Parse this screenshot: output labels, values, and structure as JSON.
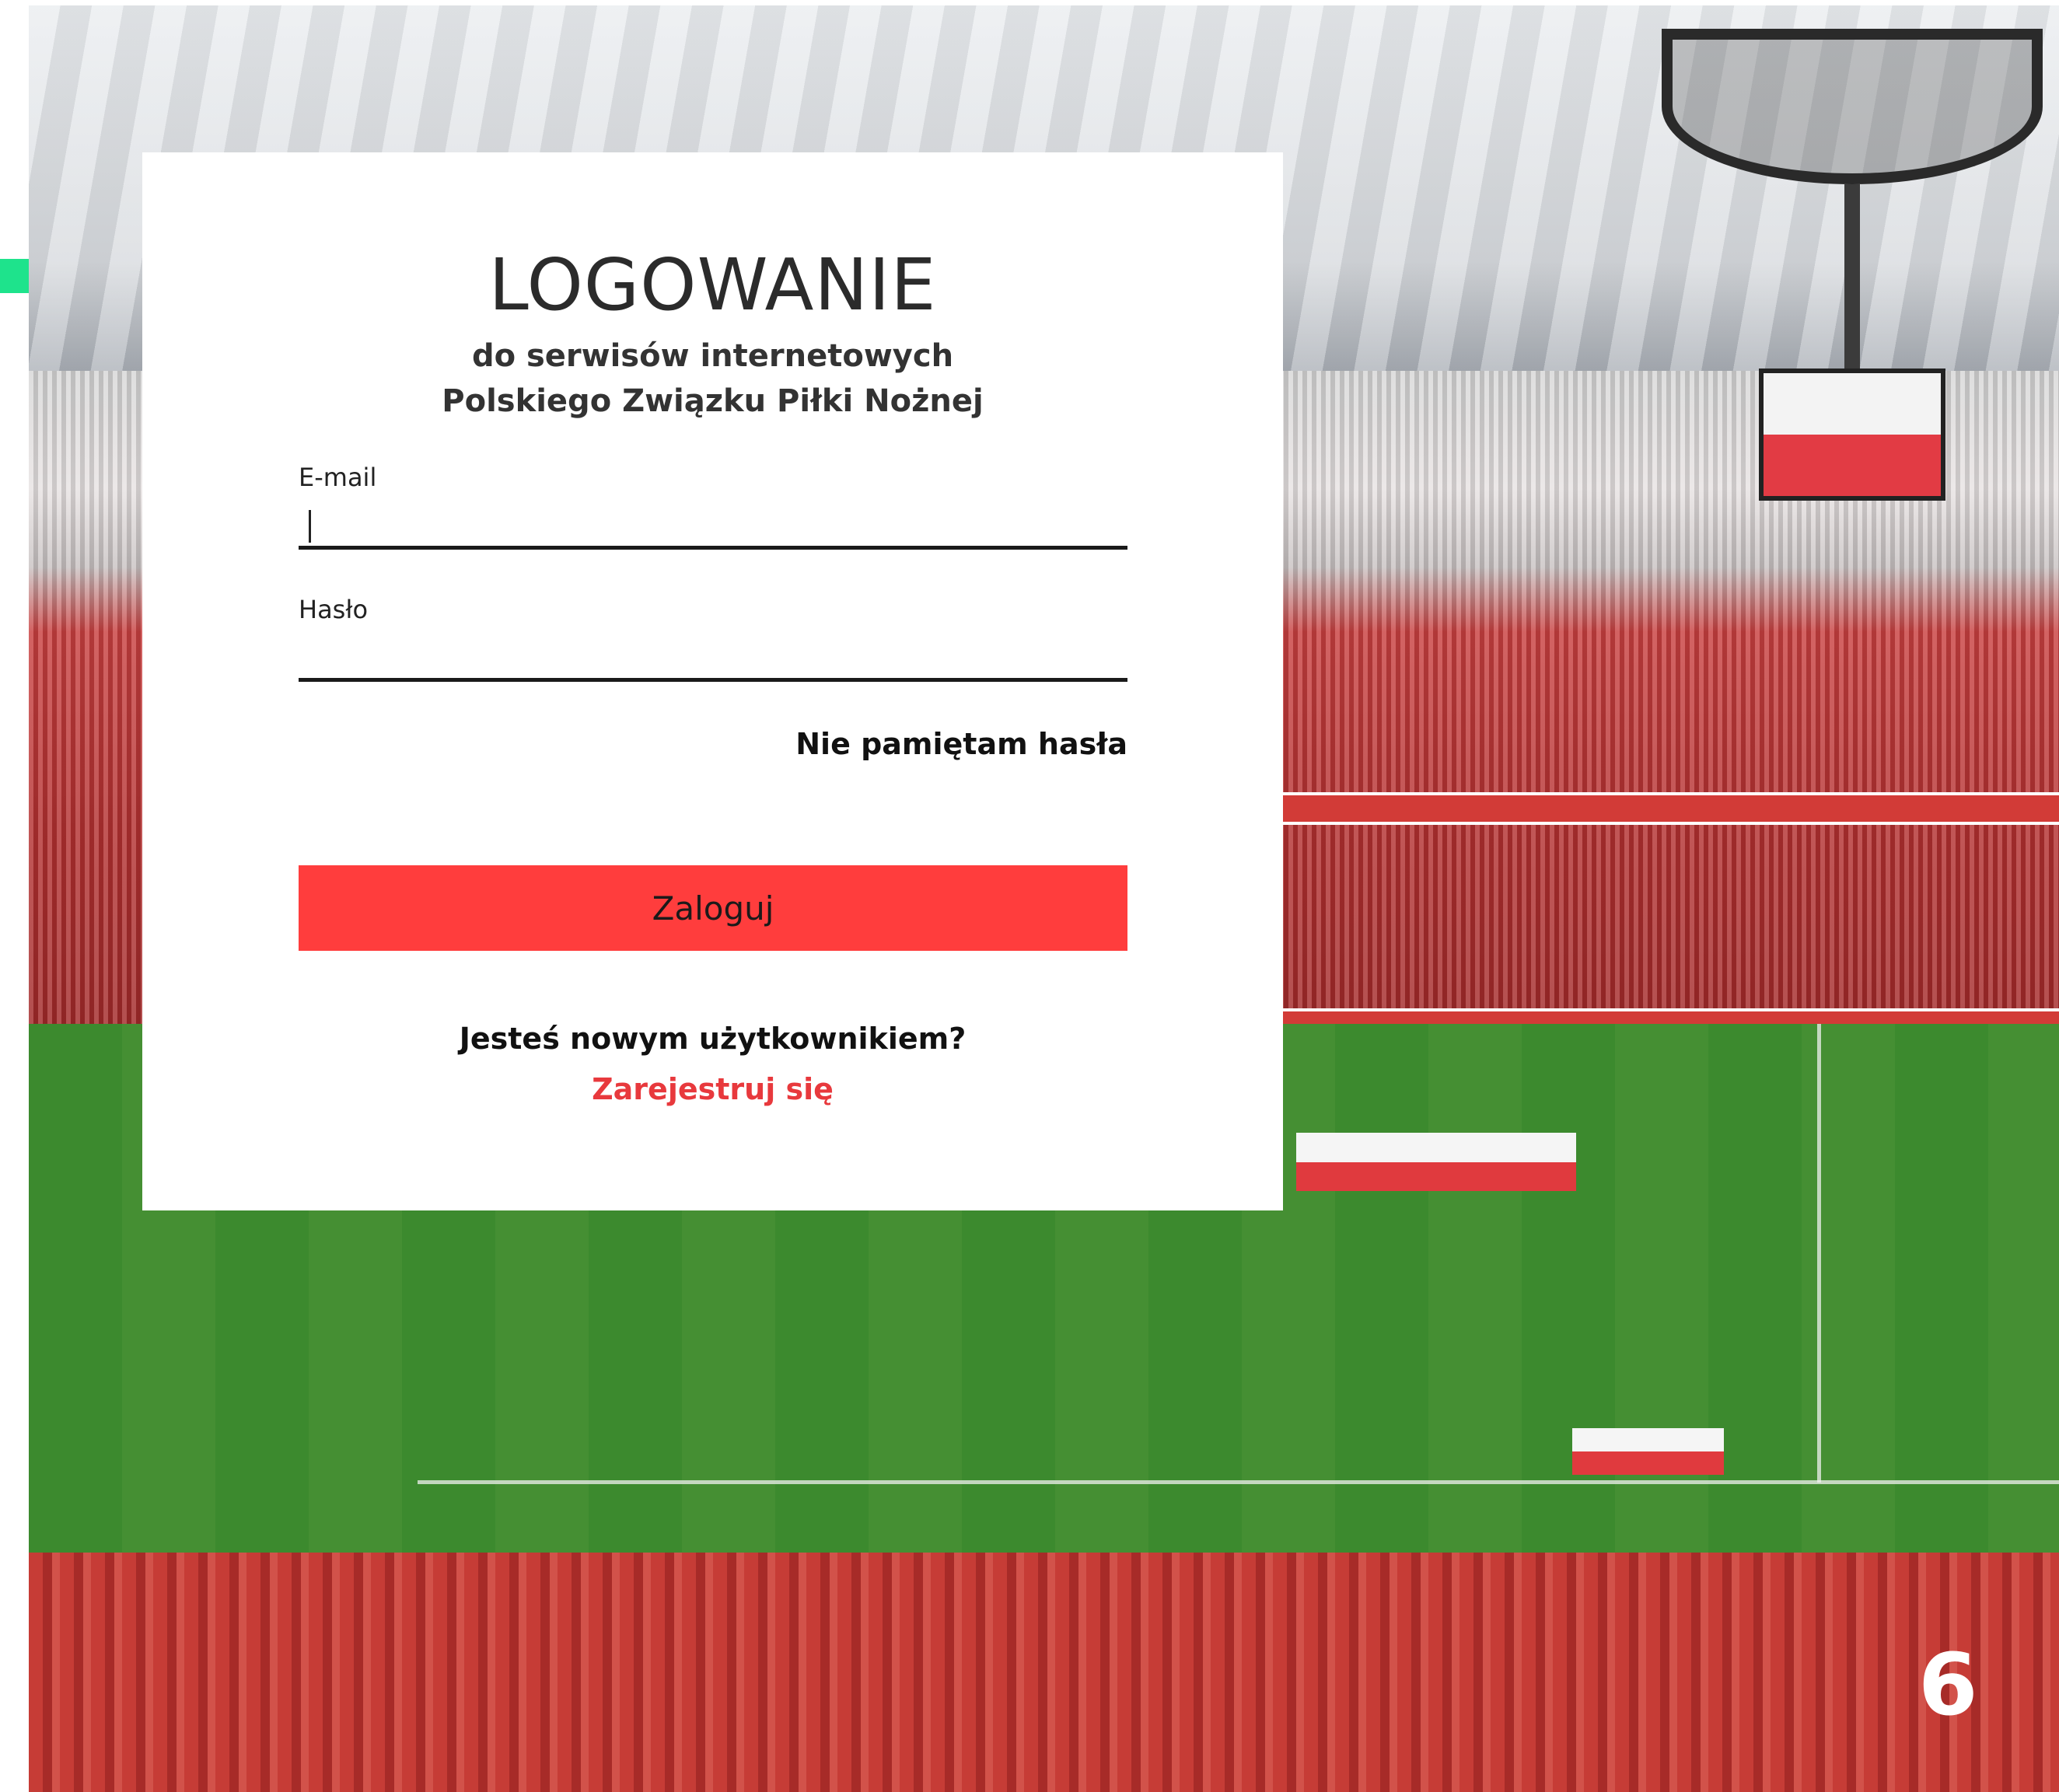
{
  "login": {
    "title": "LOGOWANIE",
    "subtitle_line1": "do serwisów internetowych",
    "subtitle_line2": "Polskiego Związku Piłki Nożnej",
    "email_label": "E-mail",
    "email_value": "",
    "password_label": "Hasło",
    "password_value": "",
    "forgot_label": "Nie pamiętam hasła",
    "submit_label": "Zaloguj",
    "new_user_text": "Jesteś nowym użytkownikiem?",
    "register_label": "Zarejestruj się"
  },
  "background": {
    "badge_text": "6"
  },
  "colors": {
    "accent_red": "#ff3d3d",
    "link_red": "#e8393d",
    "side_tab_green": "#1ee38c"
  }
}
